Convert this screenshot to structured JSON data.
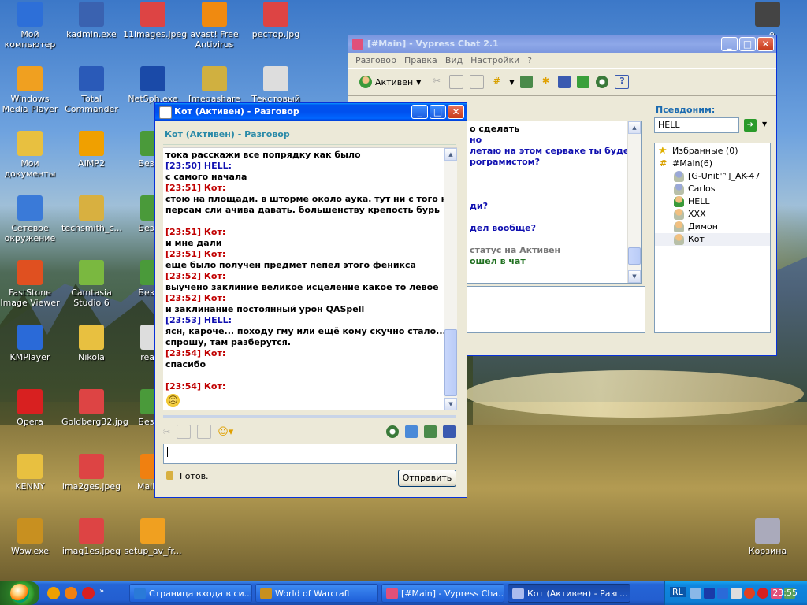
{
  "desktop": {
    "icons": [
      {
        "label": "Мой компьютер",
        "color": "#2d6fd8"
      },
      {
        "label": "kadmin.exe",
        "color": "#3a62b0"
      },
      {
        "label": "11images.jpeg",
        "color": "#d44"
      },
      {
        "label": "avast! Free Antivirus",
        "color": "#f08a10"
      },
      {
        "label": "рестор.jpg",
        "color": "#d44"
      },
      {
        "label": "Windows Media Player",
        "color": "#f0a020"
      },
      {
        "label": "Total Commander",
        "color": "#2a5ab8"
      },
      {
        "label": "NetSph.exe",
        "color": "#1a4aa8"
      },
      {
        "label": "[megashare",
        "color": "#d0b040"
      },
      {
        "label": "Текстовый",
        "color": "#ddd"
      },
      {
        "label": "Мои документы",
        "color": "#e8c040"
      },
      {
        "label": "AIMP2",
        "color": "#f0a000"
      },
      {
        "label": "Безым",
        "color": "#4a9a3a"
      },
      {
        "label": "Сетевое окружение",
        "color": "#3a7ad8"
      },
      {
        "label": "techsmith_c...",
        "color": "#d8b040"
      },
      {
        "label": "Безым",
        "color": "#4a9a3a"
      },
      {
        "label": "FastStone Image Viewer",
        "color": "#e05020"
      },
      {
        "label": "Camtasia Studio 6",
        "color": "#7ab840"
      },
      {
        "label": "Безым",
        "color": "#4a9a3a"
      },
      {
        "label": "KMPlayer",
        "color": "#2a6ad8"
      },
      {
        "label": "Nikola",
        "color": "#e8c040"
      },
      {
        "label": "realm",
        "color": "#ddd"
      },
      {
        "label": "Opera",
        "color": "#d82020"
      },
      {
        "label": "Goldberg32.jpg",
        "color": "#d44"
      },
      {
        "label": "Безым",
        "color": "#4a9a3a"
      },
      {
        "label": "KENNY",
        "color": "#e8c040"
      },
      {
        "label": "ima2ges.jpeg",
        "color": "#d44"
      },
      {
        "label": "Mail.Ru",
        "color": "#f08010"
      },
      {
        "label": "Wow.exe",
        "color": "#c89020"
      },
      {
        "label": "imag1es.jpeg",
        "color": "#d44"
      },
      {
        "label": "setup_av_fr...",
        "color": "#f0a020"
      },
      {
        "label": "Корзина",
        "color": "#aab"
      },
      {
        "label": "...e",
        "color": "#444"
      }
    ]
  },
  "vypress": {
    "title": "[#Main] - Vypress Chat 2.1",
    "menu": [
      "Разговор",
      "Правка",
      "Вид",
      "Настройки",
      "?"
    ],
    "status_button": "Активен",
    "nickname_label": "Псевдоним:",
    "nickname_value": "HELL",
    "favorites": "Избранные (0)",
    "channel": "#Main(6)",
    "users": [
      "[G-Unit™]_AK-47",
      "Carlos",
      "HELL",
      "XXX",
      "Димон",
      "Кот"
    ],
    "chat_fragments": [
      {
        "text": "о сделать",
        "cls": "t-blk"
      },
      {
        "text": "но",
        "cls": "t-blue"
      },
      {
        "text": "летаю на этом серваке ты будешь",
        "cls": "t-blue"
      },
      {
        "text": "рограмистом?",
        "cls": "t-blue"
      },
      {
        "text": "",
        "cls": "t-blk"
      },
      {
        "text": "",
        "cls": "t-blk"
      },
      {
        "text": "",
        "cls": "t-blk"
      },
      {
        "text": "ди?",
        "cls": "t-blue"
      },
      {
        "text": "",
        "cls": "t-blk"
      },
      {
        "text": "дел вообще?",
        "cls": "t-blue"
      },
      {
        "text": "",
        "cls": "t-blk"
      },
      {
        "text": "статус на Активен",
        "cls": "t-gray"
      },
      {
        "text": "ошел в чат",
        "cls": "t-green"
      }
    ]
  },
  "private": {
    "title": "Кот (Активен) - Разговор",
    "header": "Кот (Активен) - Разговор",
    "messages": [
      {
        "text": "тока расскажи все попрядку как было",
        "cls": "t-blk"
      },
      {
        "text": "[23:50] HELL:",
        "cls": "t-blue"
      },
      {
        "text": "с самого начала",
        "cls": "t-blk"
      },
      {
        "text": "[23:51] Кот:",
        "cls": "t-red"
      },
      {
        "text": "стою на площади. в шторме около аука. тут ни с того ни с сего",
        "cls": "t-blk"
      },
      {
        "text": "персам сли ачива давать. большенству крепость бурь",
        "cls": "t-blk"
      },
      {
        "text": "",
        "cls": "t-blk"
      },
      {
        "text": "[23:51] Кот:",
        "cls": "t-red"
      },
      {
        "text": "и мне дали",
        "cls": "t-blk"
      },
      {
        "text": "[23:51] Кот:",
        "cls": "t-red"
      },
      {
        "text": "еще было получен предмет пепел этого феникса",
        "cls": "t-blk"
      },
      {
        "text": "[23:52] Кот:",
        "cls": "t-red"
      },
      {
        "text": "выучено заклиние великое исцеление какое то левое",
        "cls": "t-blk"
      },
      {
        "text": "[23:52] Кот:",
        "cls": "t-red"
      },
      {
        "text": "и заклинание постоянный урон QASpell",
        "cls": "t-blk"
      },
      {
        "text": "[23:53] HELL:",
        "cls": "t-blue"
      },
      {
        "text": "ясн, кароче... походу гму или ещё кому скучно стало... ладно, я",
        "cls": "t-blk"
      },
      {
        "text": "спрошу, там разберутся.",
        "cls": "t-blk"
      },
      {
        "text": "[23:54] Кот:",
        "cls": "t-red"
      },
      {
        "text": "спасибо",
        "cls": "t-blk"
      },
      {
        "text": "",
        "cls": "t-blk"
      },
      {
        "text": "[23:54] Кот:",
        "cls": "t-red"
      }
    ],
    "emoticon": "☹",
    "status": "Готов.",
    "send_button": "Отправить",
    "input_value": ""
  },
  "taskbar": {
    "buttons": [
      {
        "label": "Страница входа в си...",
        "color": "#2a7ad8"
      },
      {
        "label": "World of Warcraft",
        "color": "#c89020"
      },
      {
        "label": "[#Main] - Vypress Cha...",
        "color": "#e0507a"
      },
      {
        "label": "Кот (Активен) - Разг...",
        "color": "#aabbee"
      }
    ],
    "lang": "RL",
    "clock": "23:55"
  }
}
